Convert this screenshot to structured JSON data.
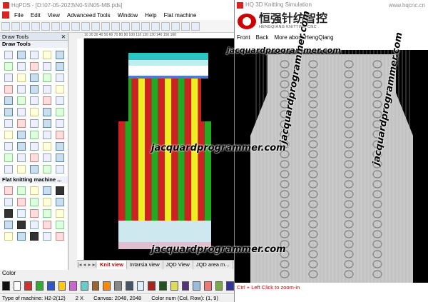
{
  "app": {
    "title": "HqPDS - [D:\\07-05-2023\\N0-5\\N05-MB.pds]",
    "menu": [
      "File",
      "Edit",
      "View",
      "Advanceed Tools",
      "Window",
      "Help",
      "Flat machine"
    ]
  },
  "panel": {
    "header": "Draw Tools",
    "section1": "Draw Tools",
    "section2": "Flat knitting machine ..."
  },
  "ruler": {
    "text": "10  20  30  40  50  60  70  80  90  100  110  120  130  140  150  160"
  },
  "tabs": [
    "Knit view",
    "Intarsia view",
    "JQD View",
    "JQD area m..."
  ],
  "colorbar": {
    "label": "Color"
  },
  "status": {
    "machine": "Type of machine: H2-2(12)",
    "zoom": "2 X",
    "canvas": "Canvas: 2048, 2048",
    "colnum": "Color num (Col, Row): (1, 9)"
  },
  "sim": {
    "title": "HQ 3D Knitting Simulation",
    "url": "www.hqcnc.cn",
    "brand_cn": "恒强针纺智控",
    "brand_en": "HENGQIANG KNITTING CNC",
    "menu": [
      "Front",
      "Back",
      "More about HengQiang"
    ],
    "hint": "Ctrl + Left Click to zoom-in"
  },
  "watermarks": [
    "jacquardprogrammer.com",
    "jacquardprogrammer.com",
    "jacquardprogrammer.com",
    "jacquardprogrammer.com",
    "jacquardprogrammer.com"
  ],
  "colors": {
    "swatches": [
      "#111111",
      "#ffffff",
      "#cc3333",
      "#33aa33",
      "#3355cc",
      "#ffcc00",
      "#cc66cc",
      "#66cccc",
      "#996633",
      "#ff8800",
      "#888888",
      "#445566",
      "#ddeeff",
      "#aa2222",
      "#225522",
      "#dddd55",
      "#553377",
      "#99bbdd",
      "#ee7777",
      "#77aa44",
      "#333399"
    ]
  }
}
